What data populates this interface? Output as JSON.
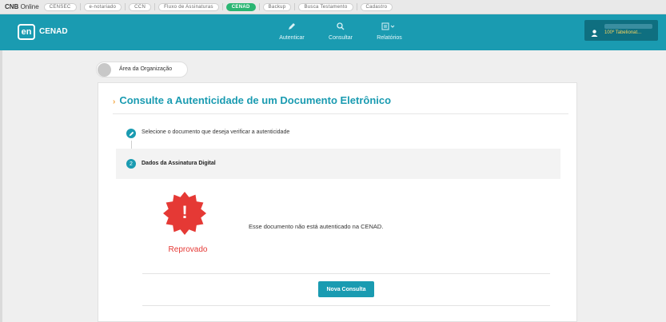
{
  "topbar": {
    "brand_bold": "CNB",
    "brand_rest": "Online",
    "tabs": [
      "CENSEC",
      "e-notariado",
      "CCN",
      "Fluxo de Assinaturas",
      "CENAD",
      "Backup",
      "Busca Testamento",
      "Cadastro"
    ],
    "active_tab": "CENAD"
  },
  "header": {
    "logo": "en",
    "app_name": "CENAD",
    "nav": [
      {
        "label": "Autenticar",
        "icon": "pencil-icon"
      },
      {
        "label": "Consultar",
        "icon": "search-icon"
      },
      {
        "label": "Relatórios",
        "icon": "report-icon"
      }
    ],
    "user": {
      "role": "100º Tabelionat..."
    }
  },
  "breadcrumb": {
    "label": "Área da Organização"
  },
  "card": {
    "title": "Consulte a Autenticidade de um Documento Eletrônico",
    "step1": {
      "label": "Selecione o documento que deseja verificar a autenticidade"
    },
    "step2": {
      "number": "2",
      "label": "Dados da Assinatura Digital"
    },
    "result": {
      "status": "Reprovado",
      "message": "Esse documento não está autenticado na CENAD.",
      "badge_mark": "!"
    },
    "button": "Nova Consulta"
  },
  "colors": {
    "accent": "#1a9bb1",
    "success": "#2bb673",
    "error": "#e53935",
    "role": "#f4d35e"
  }
}
